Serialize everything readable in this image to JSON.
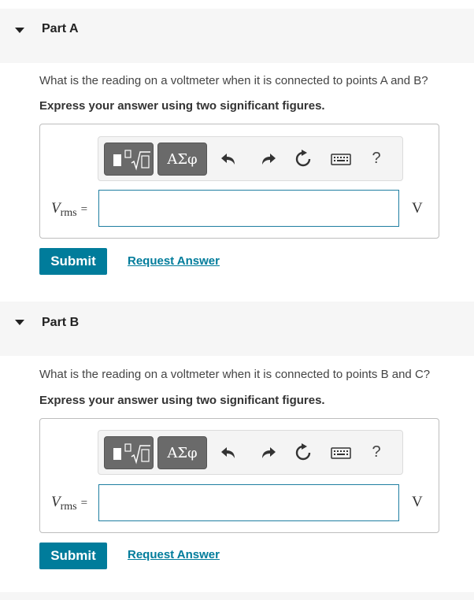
{
  "parts": [
    {
      "title": "Part A",
      "question": "What is the reading on a voltmeter when it is connected to points A and B?",
      "instruction": "Express your answer using two significant figures.",
      "variable": "V",
      "variable_sub": "rms",
      "equals": "=",
      "unit": "V",
      "answer_value": "",
      "submit_label": "Submit",
      "request_label": "Request Answer"
    },
    {
      "title": "Part B",
      "question": "What is the reading on a voltmeter when it is connected to points B and C?",
      "instruction": "Express your answer using two significant figures.",
      "variable": "V",
      "variable_sub": "rms",
      "equals": "=",
      "unit": "V",
      "answer_value": "",
      "submit_label": "Submit",
      "request_label": "Request Answer"
    }
  ],
  "toolbar": {
    "greek_label": "ΑΣφ",
    "help_label": "?",
    "icons": [
      "templates-icon",
      "greek-letters-icon",
      "undo-icon",
      "redo-icon",
      "reset-icon",
      "keyboard-icon",
      "help-icon"
    ]
  },
  "colors": {
    "accent": "#007c9b",
    "input_border": "#1f7ea1",
    "toolbar_button": "#6a6a6a",
    "header_bg": "#f6f6f6"
  }
}
